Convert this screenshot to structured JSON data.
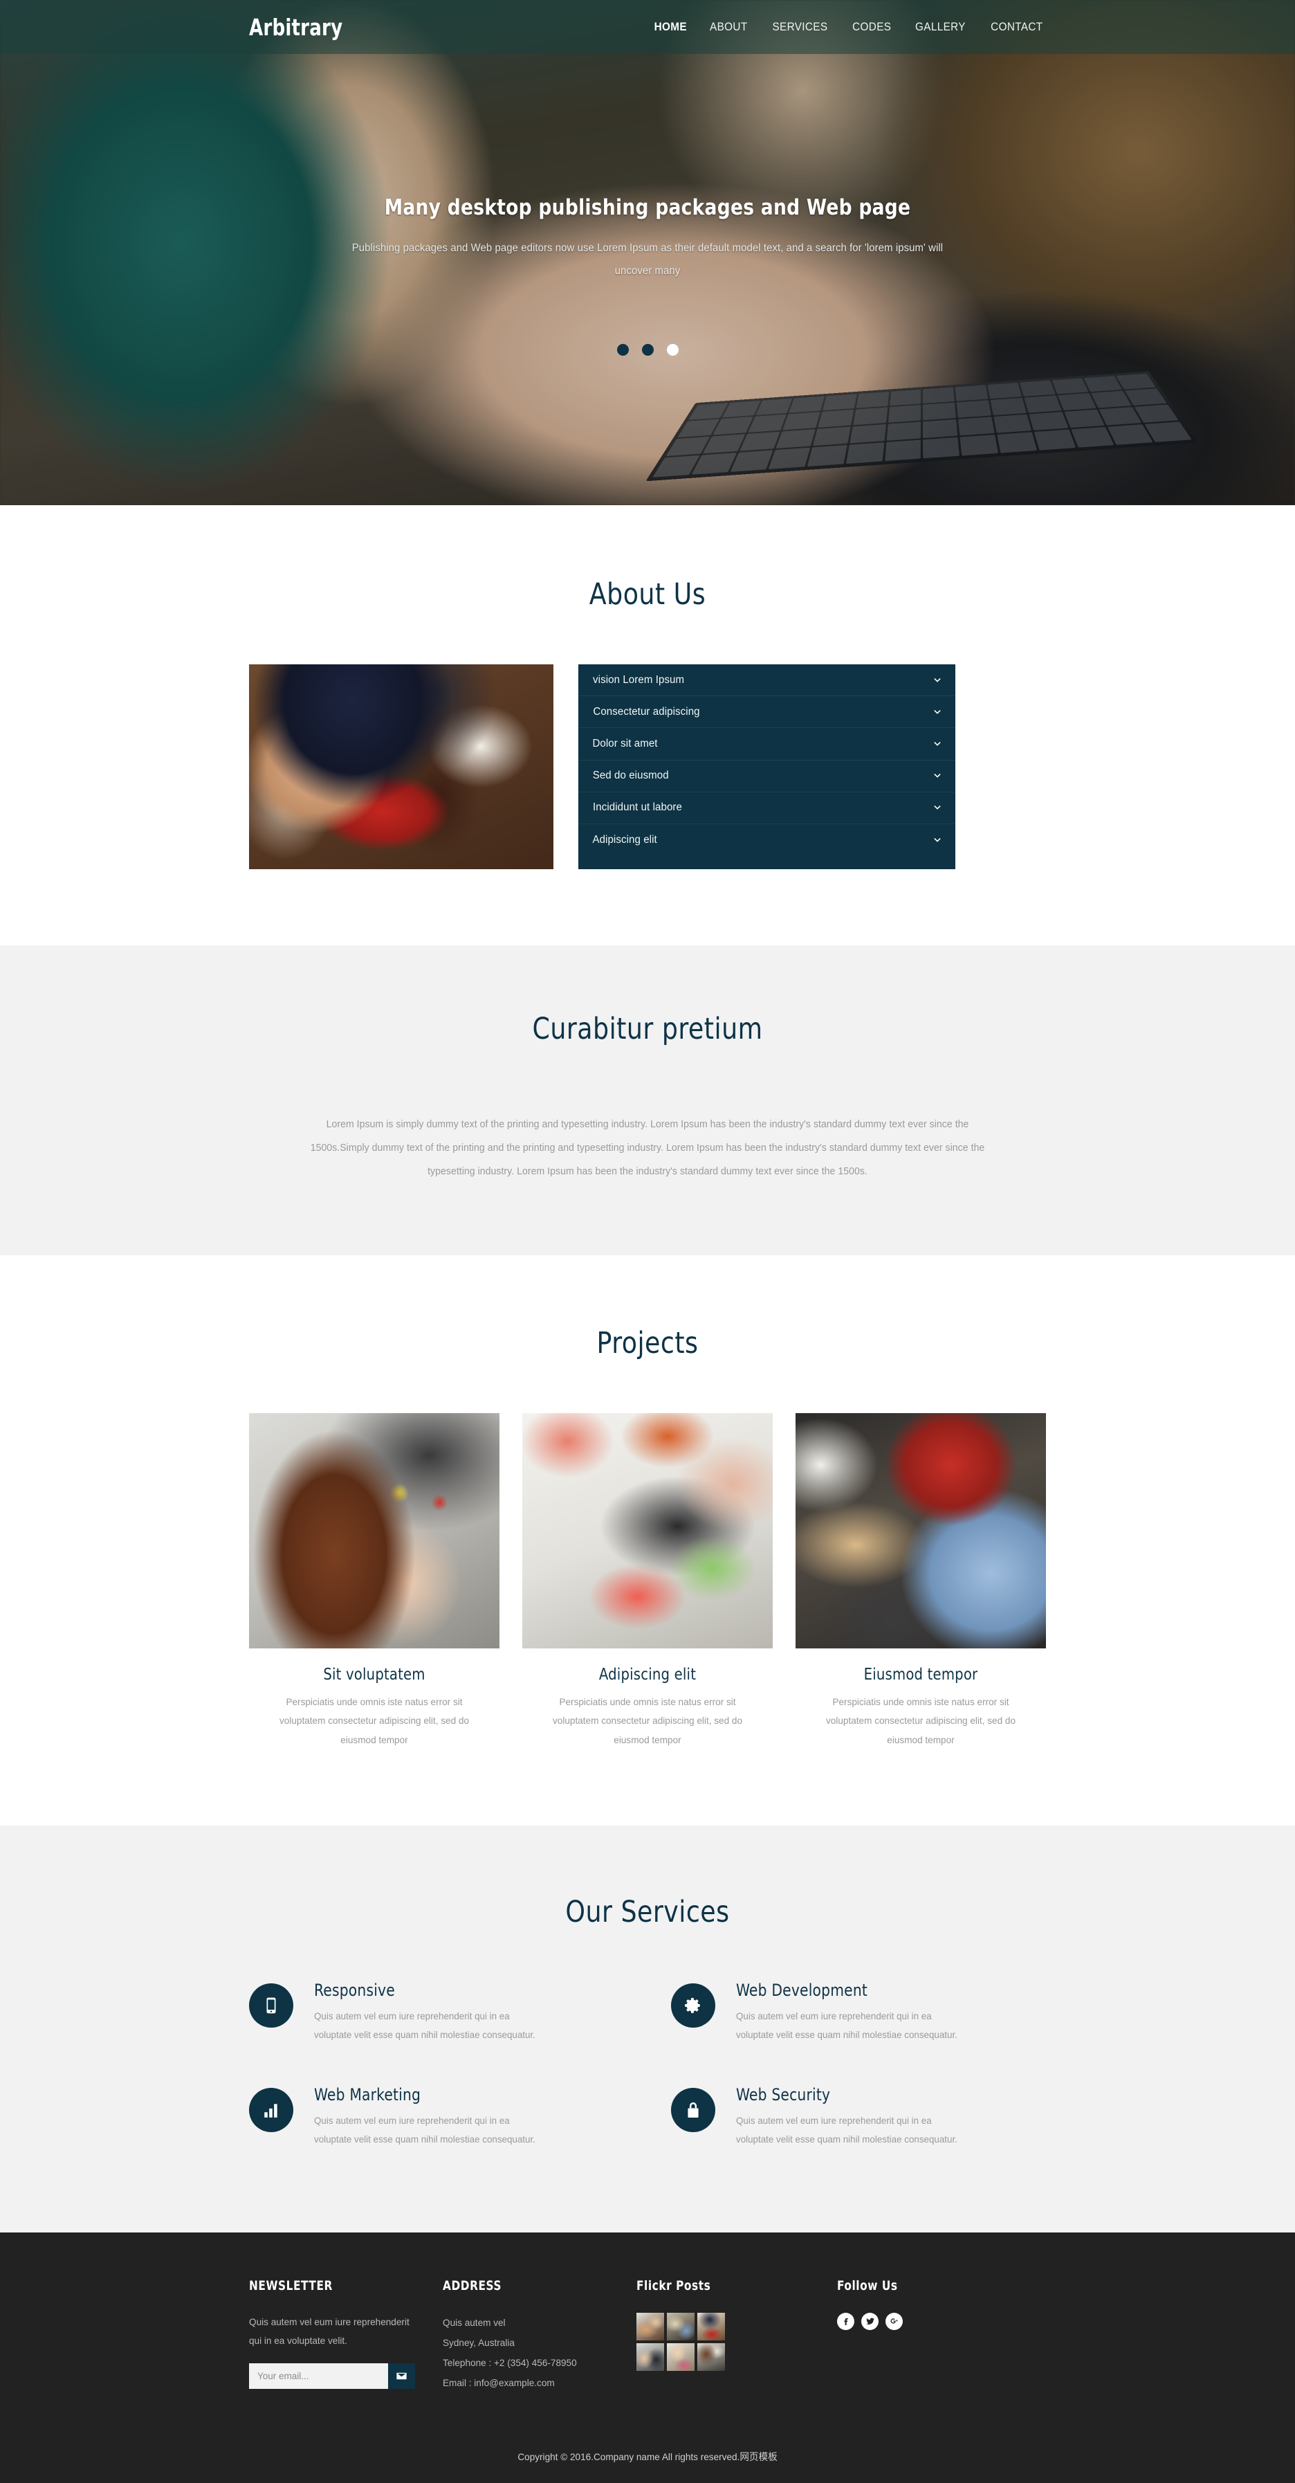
{
  "header": {
    "logo": "Arbitrary",
    "nav": [
      {
        "label": "HOME",
        "active": true
      },
      {
        "label": "ABOUT",
        "active": false
      },
      {
        "label": "SERVICES",
        "active": false
      },
      {
        "label": "CODES",
        "active": false
      },
      {
        "label": "GALLERY",
        "active": false
      },
      {
        "label": "CONTACT",
        "active": false
      }
    ]
  },
  "hero": {
    "title": "Many desktop publishing packages and Web page",
    "subtitle": "Publishing packages and Web page editors now use Lorem Ipsum as their default model text, and a search for 'lorem ipsum' will uncover many",
    "slider_dots": 3,
    "active_dot_index": 2
  },
  "about": {
    "title": "About Us",
    "image_icon": "team-meeting-photo",
    "accordion": [
      {
        "label": "vision Lorem Ipsum",
        "icon": "chevron-down-icon"
      },
      {
        "label": "Consectetur adipiscing",
        "icon": "chevron-down-icon"
      },
      {
        "label": "Dolor sit amet",
        "icon": "chevron-down-icon"
      },
      {
        "label": "Sed do eiusmod",
        "icon": "chevron-down-icon"
      },
      {
        "label": "Incididunt ut labore",
        "icon": "chevron-down-icon"
      },
      {
        "label": "Adipiscing elit",
        "icon": "chevron-down-icon"
      }
    ]
  },
  "curabitur": {
    "title": "Curabitur pretium",
    "body": "Lorem Ipsum is simply dummy text of the printing and typesetting industry. Lorem Ipsum has been the industry's standard dummy text ever since the 1500s.Simply dummy text of the printing and the printing and typesetting industry. Lorem Ipsum has been the industry's standard dummy text ever since the typesetting industry. Lorem Ipsum has been the industry's standard dummy text ever since the 1500s."
  },
  "projects": {
    "title": "Projects",
    "items": [
      {
        "title": "Sit voluptatem",
        "desc": "Perspiciatis unde omnis iste natus error sit voluptatem consectetur adipiscing elit, sed do eiusmod tempor",
        "image_icon": "woman-whiteboard-photo"
      },
      {
        "title": "Adipiscing elit",
        "desc": "Perspiciatis unde omnis iste natus error sit voluptatem consectetur adipiscing elit, sed do eiusmod tempor",
        "image_icon": "desk-planning-photo"
      },
      {
        "title": "Eiusmod tempor",
        "desc": "Perspiciatis unde omnis iste natus error sit voluptatem consectetur adipiscing elit, sed do eiusmod tempor",
        "image_icon": "office-coworkers-photo"
      }
    ]
  },
  "services": {
    "title": "Our Services",
    "items": [
      {
        "title": "Responsive",
        "desc": "Quis autem vel eum iure reprehenderit qui in ea voluptate velit esse quam nihil molestiae consequatur.",
        "icon": "mobile-phone-icon"
      },
      {
        "title": "Web Development",
        "desc": "Quis autem vel eum iure reprehenderit qui in ea voluptate velit esse quam nihil molestiae consequatur.",
        "icon": "gear-icon"
      },
      {
        "title": "Web Marketing",
        "desc": "Quis autem vel eum iure reprehenderit qui in ea voluptate velit esse quam nihil molestiae consequatur.",
        "icon": "bar-chart-icon"
      },
      {
        "title": "Web Security",
        "desc": "Quis autem vel eum iure reprehenderit qui in ea voluptate velit esse quam nihil molestiae consequatur.",
        "icon": "lock-icon"
      }
    ]
  },
  "footer": {
    "newsletter": {
      "heading": "NEWSLETTER",
      "text": "Quis autem vel eum iure reprehenderit qui in ea voluptate velit.",
      "input_placeholder": "Your email...",
      "input_value": "",
      "submit_icon": "envelope-icon"
    },
    "address": {
      "heading": "ADDRESS",
      "lines": [
        "Quis autem vel",
        "Sydney, Australia",
        "Telephone : +2 (354) 456-78950",
        "Email : info@example.com"
      ]
    },
    "flickr": {
      "heading": "Flickr Posts",
      "thumbs": [
        "flickr-thumb-1",
        "flickr-thumb-2",
        "flickr-thumb-3",
        "flickr-thumb-4",
        "flickr-thumb-5",
        "flickr-thumb-6"
      ]
    },
    "follow": {
      "heading": "Follow Us",
      "socials": [
        {
          "name": "facebook-icon"
        },
        {
          "name": "twitter-icon"
        },
        {
          "name": "google-plus-icon"
        }
      ]
    },
    "copyright": "Copyright © 2016.Company name All rights reserved.网页模板"
  },
  "colors": {
    "brand_dark": "#0d3344",
    "heading": "#0e3347",
    "muted_text": "#9a9a9a",
    "section_grey": "#f2f2f2",
    "footer_bg": "#222222"
  }
}
